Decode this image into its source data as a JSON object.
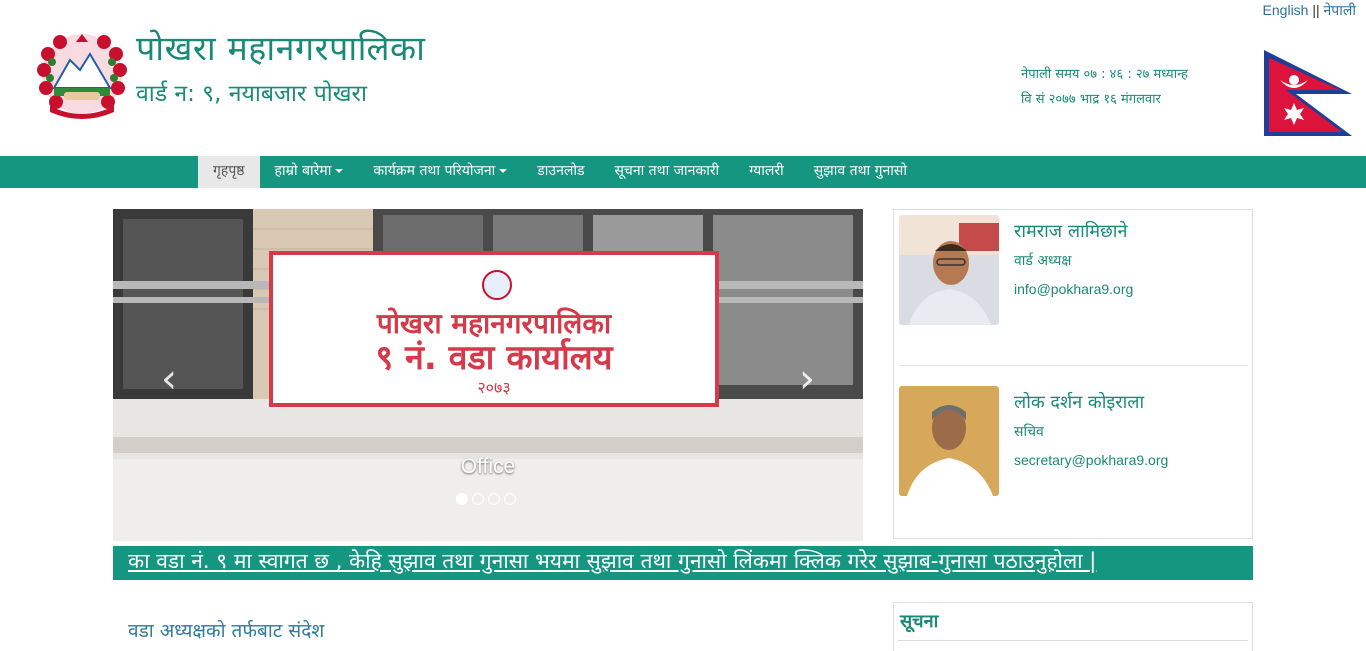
{
  "header": {
    "lang_english": "English",
    "lang_sep": " || ",
    "lang_nepali": "नेपाली",
    "title": "पोखरा महानगरपालिका",
    "subtitle": "वार्ड न: ९, नयाबजार पोखरा",
    "time_line": "नेपाली समय ०७ : ४६ : २७ मध्यान्ह",
    "date_line": "वि सं २०७७ भाद्र १६ मंगलवार"
  },
  "nav": {
    "items": [
      {
        "label": "गृहपृष्ठ",
        "active": true,
        "dropdown": false
      },
      {
        "label": "हाम्रो बारेमा",
        "active": false,
        "dropdown": true
      },
      {
        "label": "कार्यक्रम तथा परियोजना",
        "active": false,
        "dropdown": true
      },
      {
        "label": "डाउनलोड",
        "active": false,
        "dropdown": false
      },
      {
        "label": "सूचना तथा जानकारी",
        "active": false,
        "dropdown": false
      },
      {
        "label": "ग्यालरी",
        "active": false,
        "dropdown": false
      },
      {
        "label": "सुझाव तथा गुनासो",
        "active": false,
        "dropdown": false
      }
    ]
  },
  "carousel": {
    "caption": "Office",
    "sign_line1": "पोखरा महानगरपालिका",
    "sign_line2": "९ नं. वडा कार्यालय",
    "sign_line3": "२०७३",
    "slide_count": 4,
    "active_slide": 1,
    "prev_icon": "chevron-left-icon",
    "next_icon": "chevron-right-icon"
  },
  "officials": [
    {
      "name": "रामराज लामिछाने",
      "role": "वार्ड अध्यक्ष",
      "email": "info@pokhara9.org"
    },
    {
      "name": "लोक दर्शन कोइराला",
      "role": "सचिव",
      "email": "secretary@pokhara9.org"
    }
  ],
  "marquee": {
    "text": "का वडा नं. ९ मा स्वागत छ , केहि सुझाव तथा गुनासा भयमा सुझाव तथा गुनासो लिंकमा क्लिक गरेर सुझाब-गुनासा पठाउनुहोला |"
  },
  "message": {
    "title": "वडा अध्यक्षको  तर्फबाट संदेश"
  },
  "notice": {
    "title": "सूचना"
  },
  "colors": {
    "brand": "#159681",
    "text_teal": "#1a8a78",
    "link_blue": "#2e6f9e"
  }
}
